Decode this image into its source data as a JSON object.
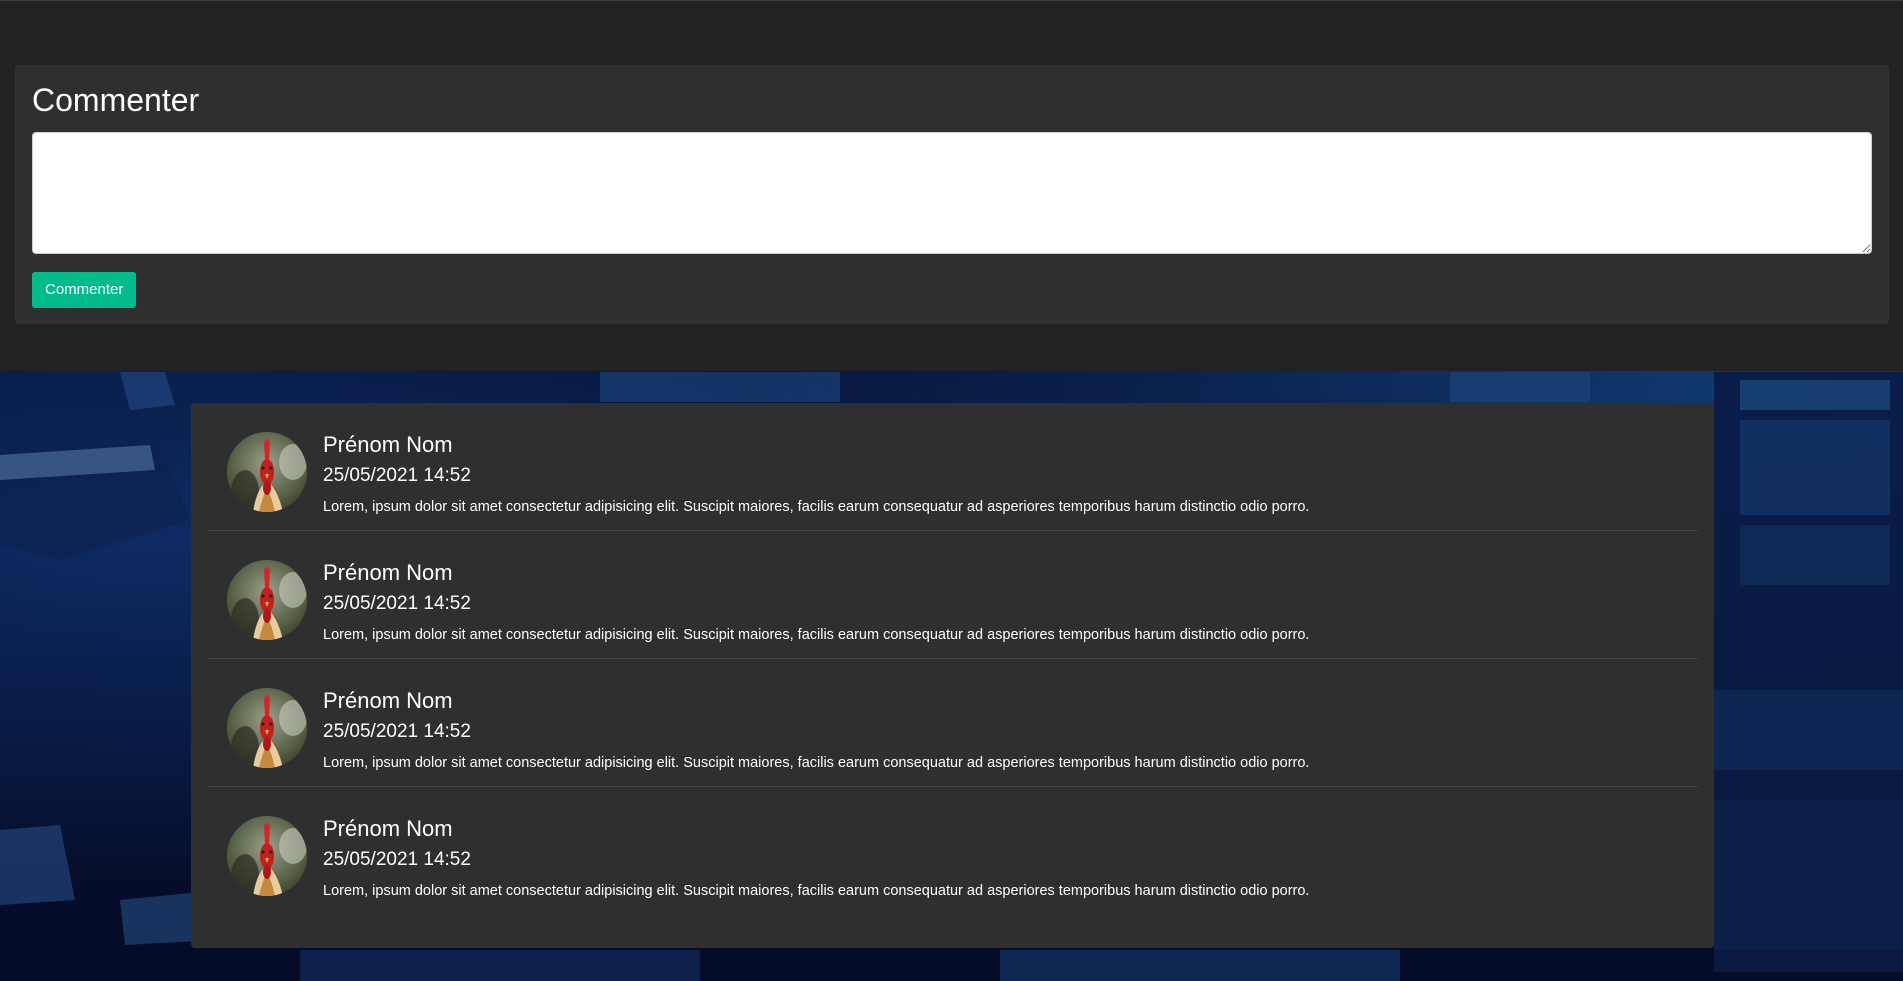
{
  "form": {
    "title": "Commenter",
    "textarea_value": "",
    "submit_label": "Commenter"
  },
  "comments": [
    {
      "author": "Prénom Nom",
      "date": "25/05/2021 14:52",
      "text": "Lorem, ipsum dolor sit amet consectetur adipisicing elit. Suscipit maiores, facilis earum consequatur ad asperiores temporibus harum distinctio odio porro."
    },
    {
      "author": "Prénom Nom",
      "date": "25/05/2021 14:52",
      "text": "Lorem, ipsum dolor sit amet consectetur adipisicing elit. Suscipit maiores, facilis earum consequatur ad asperiores temporibus harum distinctio odio porro."
    },
    {
      "author": "Prénom Nom",
      "date": "25/05/2021 14:52",
      "text": "Lorem, ipsum dolor sit amet consectetur adipisicing elit. Suscipit maiores, facilis earum consequatur ad asperiores temporibus harum distinctio odio porro."
    },
    {
      "author": "Prénom Nom",
      "date": "25/05/2021 14:52",
      "text": "Lorem, ipsum dolor sit amet consectetur adipisicing elit. Suscipit maiores, facilis earum consequatur ad asperiores temporibus harum distinctio odio porro."
    }
  ],
  "avatar_icon": "rooster-photo",
  "colors": {
    "accent": "#00bc8c",
    "card": "#2f2f2f",
    "top_section": "#222222",
    "background": "#061233"
  }
}
